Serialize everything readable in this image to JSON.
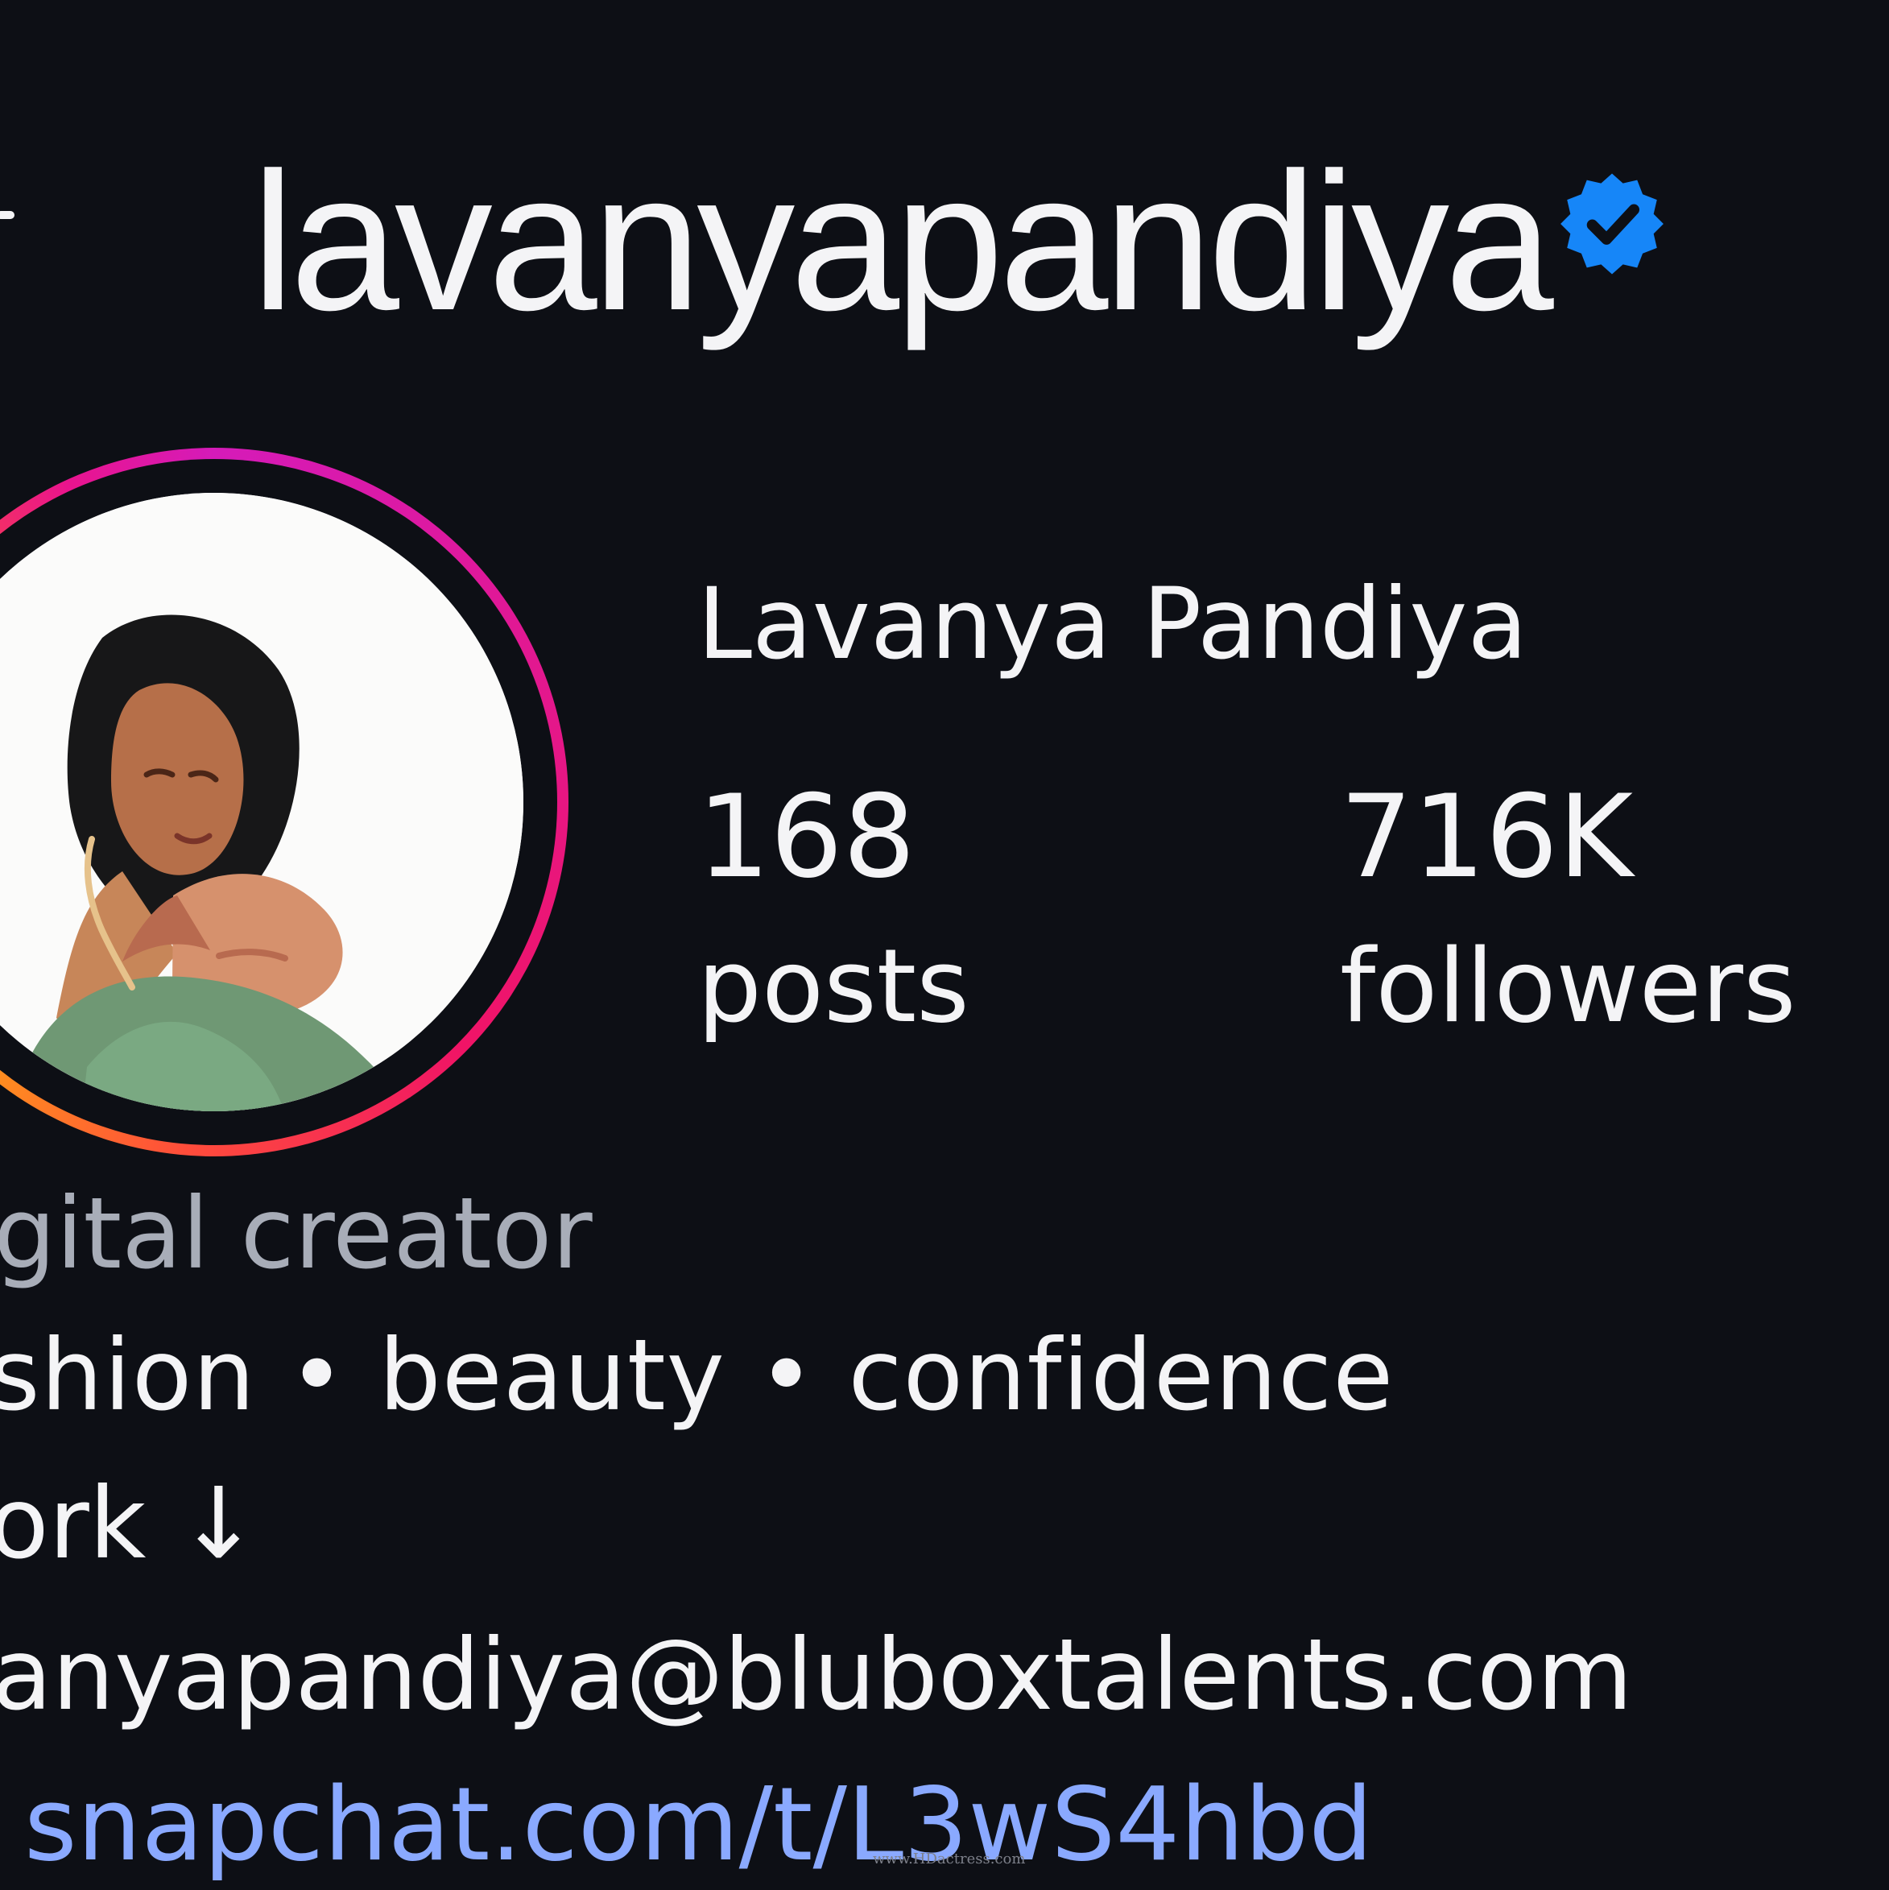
{
  "profile": {
    "username": "lavanyapandiya",
    "verified_icon": "verified-badge-icon",
    "display_name": "Lavanya Pandiya",
    "posts_count": "168",
    "posts_label": "posts",
    "followers_count": "716K",
    "followers_label": "followers",
    "category": "gital creator",
    "tags": "shion • beauty •  confidence",
    "work_line": "ork ↓",
    "email_line": "anyapandiya@bluboxtalents.com",
    "link": "snapchat.com/t/L3wS4hbd",
    "watermark": "www.HDactress.com"
  },
  "colors": {
    "background": "#0d0f15",
    "primary_text": "#f4f4f6",
    "secondary_text": "#a8adb8",
    "link": "#8aa9ff",
    "verified": "#1686f8",
    "story_ring_start": "#d51bb9",
    "story_ring_end": "#f0d21b"
  },
  "icons": {
    "back": "back-arrow-icon",
    "verified": "verified-badge-icon",
    "profile_avatar": "profile-avatar"
  }
}
